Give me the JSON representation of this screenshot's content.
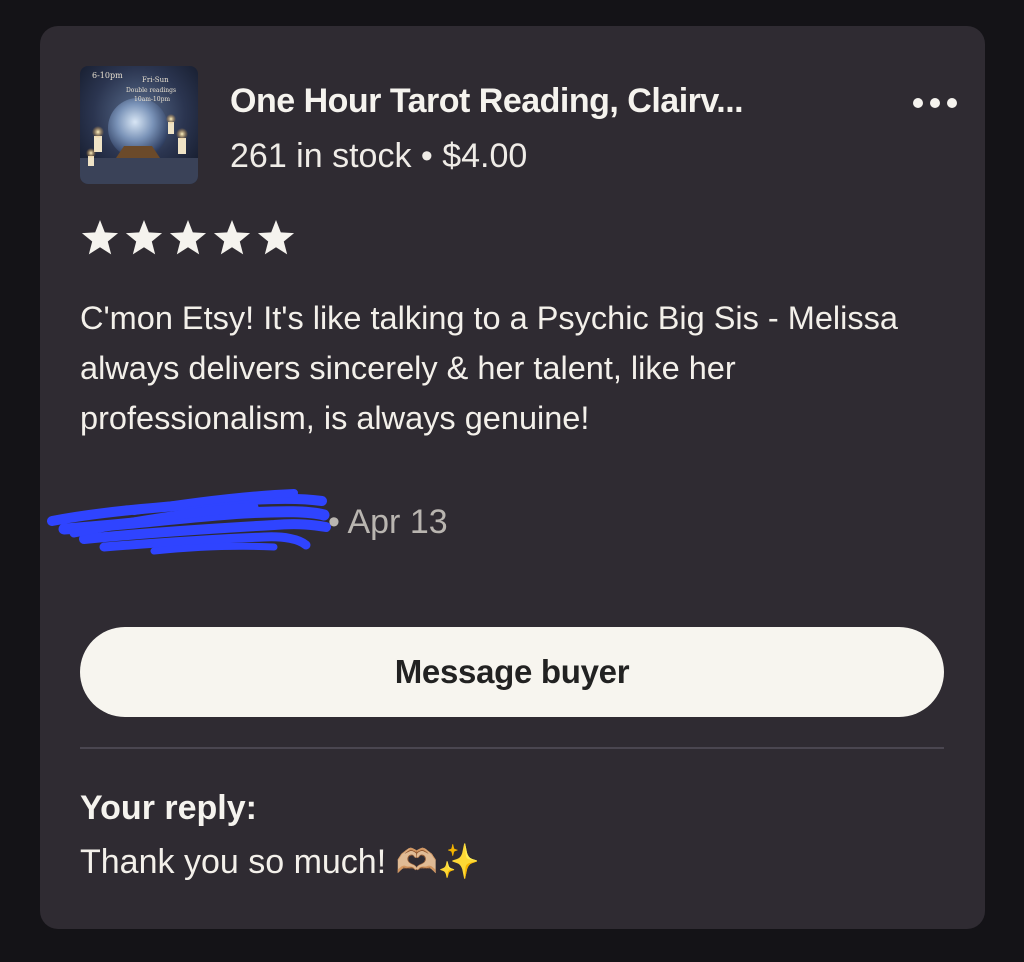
{
  "listing": {
    "title": "One Hour Tarot Reading, Clairv...",
    "stock_price": "261 in stock • $4.00",
    "more_icon": "more-horizontal-icon",
    "thumbnail_text": [
      "6-10pm",
      "Fri-Sun",
      "Double readings",
      "10am-10pm"
    ]
  },
  "rating": {
    "stars": 5,
    "max": 5,
    "icon": "star-icon",
    "color": "#f5f3ee"
  },
  "review": {
    "text": "C'mon Etsy! It's like talking to a Psychic Big Sis - Melissa always delivers sincerely & her talent, like her professionalism, is always genuine!",
    "date": "• Apr 13",
    "redaction_color": "#2f44ff"
  },
  "actions": {
    "message_label": "Message buyer"
  },
  "reply": {
    "label": "Your reply:",
    "text": "Thank you so much! 🫶🏼✨"
  },
  "colors": {
    "background": "#141317",
    "card": "#2f2b32",
    "button": "#f7f5ef",
    "button_text": "#222222",
    "muted_text": "#b9b5b0"
  }
}
